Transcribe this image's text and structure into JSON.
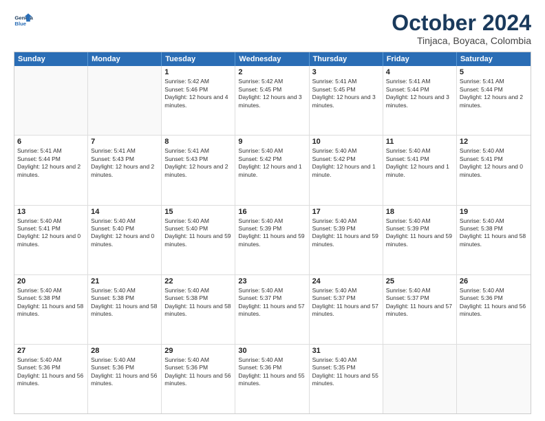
{
  "logo": {
    "line1": "General",
    "line2": "Blue"
  },
  "title": "October 2024",
  "subtitle": "Tinjaca, Boyaca, Colombia",
  "header_days": [
    "Sunday",
    "Monday",
    "Tuesday",
    "Wednesday",
    "Thursday",
    "Friday",
    "Saturday"
  ],
  "weeks": [
    [
      {
        "day": "",
        "sunrise": "",
        "sunset": "",
        "daylight": ""
      },
      {
        "day": "",
        "sunrise": "",
        "sunset": "",
        "daylight": ""
      },
      {
        "day": "1",
        "sunrise": "Sunrise: 5:42 AM",
        "sunset": "Sunset: 5:46 PM",
        "daylight": "Daylight: 12 hours and 4 minutes."
      },
      {
        "day": "2",
        "sunrise": "Sunrise: 5:42 AM",
        "sunset": "Sunset: 5:45 PM",
        "daylight": "Daylight: 12 hours and 3 minutes."
      },
      {
        "day": "3",
        "sunrise": "Sunrise: 5:41 AM",
        "sunset": "Sunset: 5:45 PM",
        "daylight": "Daylight: 12 hours and 3 minutes."
      },
      {
        "day": "4",
        "sunrise": "Sunrise: 5:41 AM",
        "sunset": "Sunset: 5:44 PM",
        "daylight": "Daylight: 12 hours and 3 minutes."
      },
      {
        "day": "5",
        "sunrise": "Sunrise: 5:41 AM",
        "sunset": "Sunset: 5:44 PM",
        "daylight": "Daylight: 12 hours and 2 minutes."
      }
    ],
    [
      {
        "day": "6",
        "sunrise": "Sunrise: 5:41 AM",
        "sunset": "Sunset: 5:44 PM",
        "daylight": "Daylight: 12 hours and 2 minutes."
      },
      {
        "day": "7",
        "sunrise": "Sunrise: 5:41 AM",
        "sunset": "Sunset: 5:43 PM",
        "daylight": "Daylight: 12 hours and 2 minutes."
      },
      {
        "day": "8",
        "sunrise": "Sunrise: 5:41 AM",
        "sunset": "Sunset: 5:43 PM",
        "daylight": "Daylight: 12 hours and 2 minutes."
      },
      {
        "day": "9",
        "sunrise": "Sunrise: 5:40 AM",
        "sunset": "Sunset: 5:42 PM",
        "daylight": "Daylight: 12 hours and 1 minute."
      },
      {
        "day": "10",
        "sunrise": "Sunrise: 5:40 AM",
        "sunset": "Sunset: 5:42 PM",
        "daylight": "Daylight: 12 hours and 1 minute."
      },
      {
        "day": "11",
        "sunrise": "Sunrise: 5:40 AM",
        "sunset": "Sunset: 5:41 PM",
        "daylight": "Daylight: 12 hours and 1 minute."
      },
      {
        "day": "12",
        "sunrise": "Sunrise: 5:40 AM",
        "sunset": "Sunset: 5:41 PM",
        "daylight": "Daylight: 12 hours and 0 minutes."
      }
    ],
    [
      {
        "day": "13",
        "sunrise": "Sunrise: 5:40 AM",
        "sunset": "Sunset: 5:41 PM",
        "daylight": "Daylight: 12 hours and 0 minutes."
      },
      {
        "day": "14",
        "sunrise": "Sunrise: 5:40 AM",
        "sunset": "Sunset: 5:40 PM",
        "daylight": "Daylight: 12 hours and 0 minutes."
      },
      {
        "day": "15",
        "sunrise": "Sunrise: 5:40 AM",
        "sunset": "Sunset: 5:40 PM",
        "daylight": "Daylight: 11 hours and 59 minutes."
      },
      {
        "day": "16",
        "sunrise": "Sunrise: 5:40 AM",
        "sunset": "Sunset: 5:39 PM",
        "daylight": "Daylight: 11 hours and 59 minutes."
      },
      {
        "day": "17",
        "sunrise": "Sunrise: 5:40 AM",
        "sunset": "Sunset: 5:39 PM",
        "daylight": "Daylight: 11 hours and 59 minutes."
      },
      {
        "day": "18",
        "sunrise": "Sunrise: 5:40 AM",
        "sunset": "Sunset: 5:39 PM",
        "daylight": "Daylight: 11 hours and 59 minutes."
      },
      {
        "day": "19",
        "sunrise": "Sunrise: 5:40 AM",
        "sunset": "Sunset: 5:38 PM",
        "daylight": "Daylight: 11 hours and 58 minutes."
      }
    ],
    [
      {
        "day": "20",
        "sunrise": "Sunrise: 5:40 AM",
        "sunset": "Sunset: 5:38 PM",
        "daylight": "Daylight: 11 hours and 58 minutes."
      },
      {
        "day": "21",
        "sunrise": "Sunrise: 5:40 AM",
        "sunset": "Sunset: 5:38 PM",
        "daylight": "Daylight: 11 hours and 58 minutes."
      },
      {
        "day": "22",
        "sunrise": "Sunrise: 5:40 AM",
        "sunset": "Sunset: 5:38 PM",
        "daylight": "Daylight: 11 hours and 58 minutes."
      },
      {
        "day": "23",
        "sunrise": "Sunrise: 5:40 AM",
        "sunset": "Sunset: 5:37 PM",
        "daylight": "Daylight: 11 hours and 57 minutes."
      },
      {
        "day": "24",
        "sunrise": "Sunrise: 5:40 AM",
        "sunset": "Sunset: 5:37 PM",
        "daylight": "Daylight: 11 hours and 57 minutes."
      },
      {
        "day": "25",
        "sunrise": "Sunrise: 5:40 AM",
        "sunset": "Sunset: 5:37 PM",
        "daylight": "Daylight: 11 hours and 57 minutes."
      },
      {
        "day": "26",
        "sunrise": "Sunrise: 5:40 AM",
        "sunset": "Sunset: 5:36 PM",
        "daylight": "Daylight: 11 hours and 56 minutes."
      }
    ],
    [
      {
        "day": "27",
        "sunrise": "Sunrise: 5:40 AM",
        "sunset": "Sunset: 5:36 PM",
        "daylight": "Daylight: 11 hours and 56 minutes."
      },
      {
        "day": "28",
        "sunrise": "Sunrise: 5:40 AM",
        "sunset": "Sunset: 5:36 PM",
        "daylight": "Daylight: 11 hours and 56 minutes."
      },
      {
        "day": "29",
        "sunrise": "Sunrise: 5:40 AM",
        "sunset": "Sunset: 5:36 PM",
        "daylight": "Daylight: 11 hours and 56 minutes."
      },
      {
        "day": "30",
        "sunrise": "Sunrise: 5:40 AM",
        "sunset": "Sunset: 5:36 PM",
        "daylight": "Daylight: 11 hours and 55 minutes."
      },
      {
        "day": "31",
        "sunrise": "Sunrise: 5:40 AM",
        "sunset": "Sunset: 5:35 PM",
        "daylight": "Daylight: 11 hours and 55 minutes."
      },
      {
        "day": "",
        "sunrise": "",
        "sunset": "",
        "daylight": ""
      },
      {
        "day": "",
        "sunrise": "",
        "sunset": "",
        "daylight": ""
      }
    ]
  ]
}
